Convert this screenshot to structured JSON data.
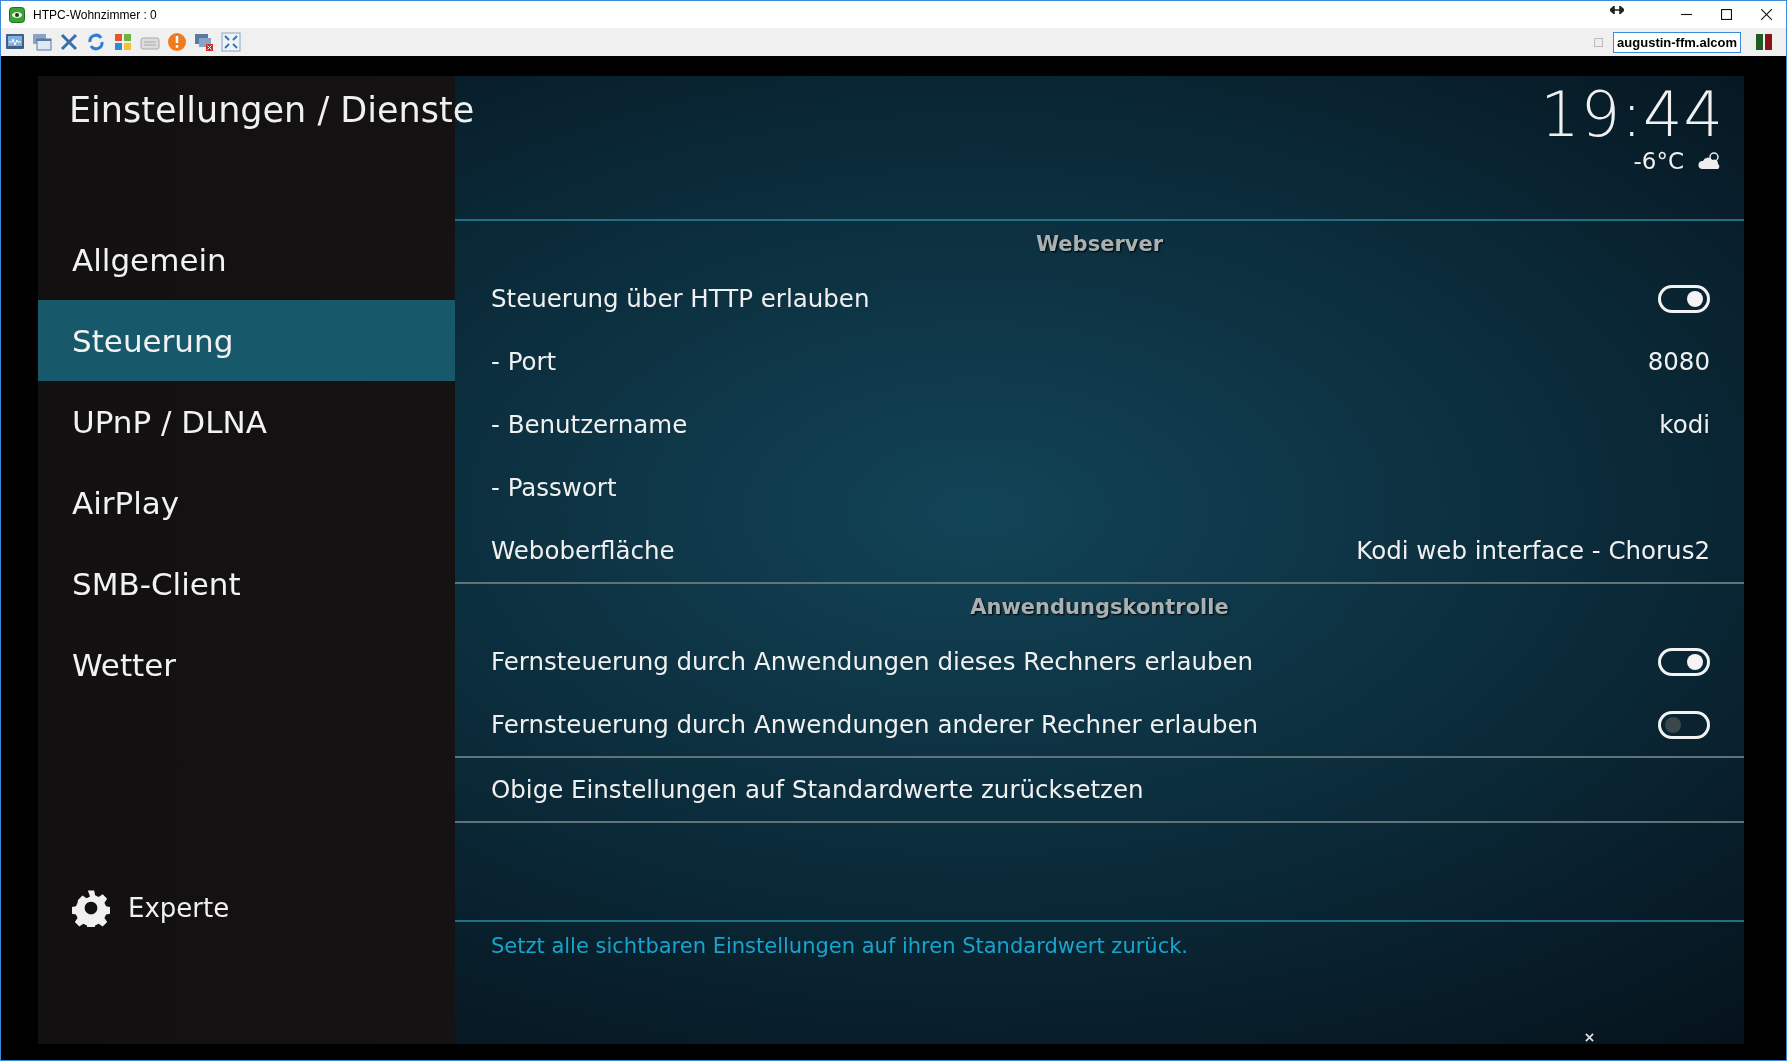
{
  "window": {
    "title": "HTPC-Wohnzimmer : 0",
    "host": "augustin-ffm.alcom"
  },
  "header": {
    "title": "Einstellungen / Dienste",
    "time": "19:44",
    "temperature": "-6°C"
  },
  "sidebar": {
    "items": [
      {
        "label": "Allgemein",
        "selected": false
      },
      {
        "label": "Steuerung",
        "selected": true
      },
      {
        "label": "UPnP / DLNA",
        "selected": false
      },
      {
        "label": "AirPlay",
        "selected": false
      },
      {
        "label": "SMB-Client",
        "selected": false
      },
      {
        "label": "Wetter",
        "selected": false
      }
    ],
    "level_label": "Experte"
  },
  "sections": [
    {
      "heading": "Webserver",
      "rows": [
        {
          "kind": "toggle",
          "label": "Steuerung über HTTP erlauben",
          "on": true
        },
        {
          "kind": "value",
          "label": "- Port",
          "value": "8080"
        },
        {
          "kind": "value",
          "label": "- Benutzername",
          "value": "kodi"
        },
        {
          "kind": "value",
          "label": "- Passwort"
        },
        {
          "kind": "value",
          "label": "Weboberfläche",
          "value": "Kodi web interface - Chorus2"
        }
      ]
    },
    {
      "heading": "Anwendungskontrolle",
      "rows": [
        {
          "kind": "toggle",
          "label": "Fernsteuerung durch Anwendungen dieses Rechners erlauben",
          "on": true
        },
        {
          "kind": "toggle",
          "label": "Fernsteuerung durch Anwendungen anderer Rechner erlauben",
          "on": false
        }
      ]
    },
    {
      "rows": [
        {
          "kind": "action",
          "label": "Obige Einstellungen auf Standardwerte zurücksetzen"
        }
      ]
    }
  ],
  "description": "Setzt alle sichtbaren Einstellungen auf ihren Standardwert zurück."
}
